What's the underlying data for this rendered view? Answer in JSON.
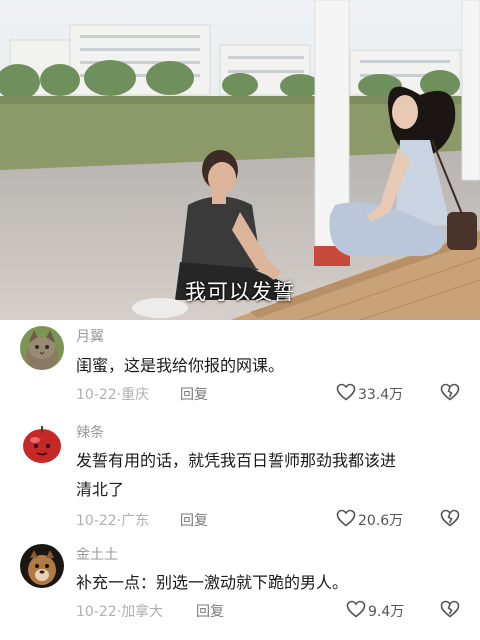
{
  "video": {
    "subtitle": "我可以发誓"
  },
  "comments": [
    {
      "username": "月翼",
      "text_lines": [
        "闺蜜，这是我给你报的网课。"
      ],
      "date": "10-22",
      "location": "重庆",
      "reply_label": "回复",
      "likes": "33.4万",
      "avatar": "cat-avatar"
    },
    {
      "username": "辣条",
      "text_lines": [
        "发誓有用的话，就凭我百日誓师那劲我都该进",
        "清北了"
      ],
      "date": "10-22",
      "location": "广东",
      "reply_label": "回复",
      "likes": "20.6万",
      "avatar": "apple-avatar"
    },
    {
      "username": "金土土",
      "text_lines": [
        "补充一点：别选一激动就下跪的男人。"
      ],
      "date": "10-22",
      "location": "加拿大",
      "reply_label": "回复",
      "likes": "9.4万",
      "avatar": "animal-avatar"
    }
  ],
  "icons": {
    "like": "heart-outline-icon",
    "dislike": "broken-heart-icon"
  },
  "colors": {
    "text_primary": "#1a1a1a",
    "text_secondary": "#9a9a9a"
  }
}
